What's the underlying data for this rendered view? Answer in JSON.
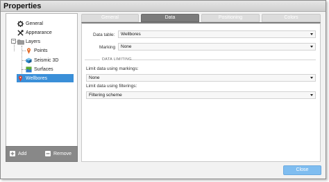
{
  "window": {
    "title": "Properties"
  },
  "tree": {
    "items": [
      {
        "label": "General",
        "icon": "gear-icon"
      },
      {
        "label": "Appearance",
        "icon": "brush-tools-icon"
      },
      {
        "label": "Layers",
        "icon": "folder-icon",
        "expander": "−"
      },
      {
        "label": "Points",
        "icon": "pin-icon"
      },
      {
        "label": "Seismic 3D",
        "icon": "cube-icon"
      },
      {
        "label": "Surfaces",
        "icon": "surface-icon"
      },
      {
        "label": "Wellbores",
        "icon": "wellbore-pin-icon",
        "selected": true
      }
    ],
    "footer": {
      "add_label": "Add",
      "remove_label": "Remove"
    }
  },
  "tabs": [
    {
      "label": "General",
      "active": false
    },
    {
      "label": "Data",
      "active": true
    },
    {
      "label": "Positioning",
      "active": false
    },
    {
      "label": "Colors",
      "active": false
    }
  ],
  "data_tab": {
    "data_table_label": "Data table:",
    "data_table_value": "Wellbores",
    "marking_label": "Marking",
    "marking_value": "None",
    "section_title": "DATA LIMITING",
    "markings_label": "Limit data using markings:",
    "markings_value": "None",
    "filterings_label": "Limit data using filterings:",
    "filterings_value": "Filtering scheme"
  },
  "buttons": {
    "close_label": "Close"
  },
  "colors": {
    "selected": "#3a8fd8",
    "active_tab": "#7b7b7b",
    "close_button": "#7fbdf0"
  }
}
